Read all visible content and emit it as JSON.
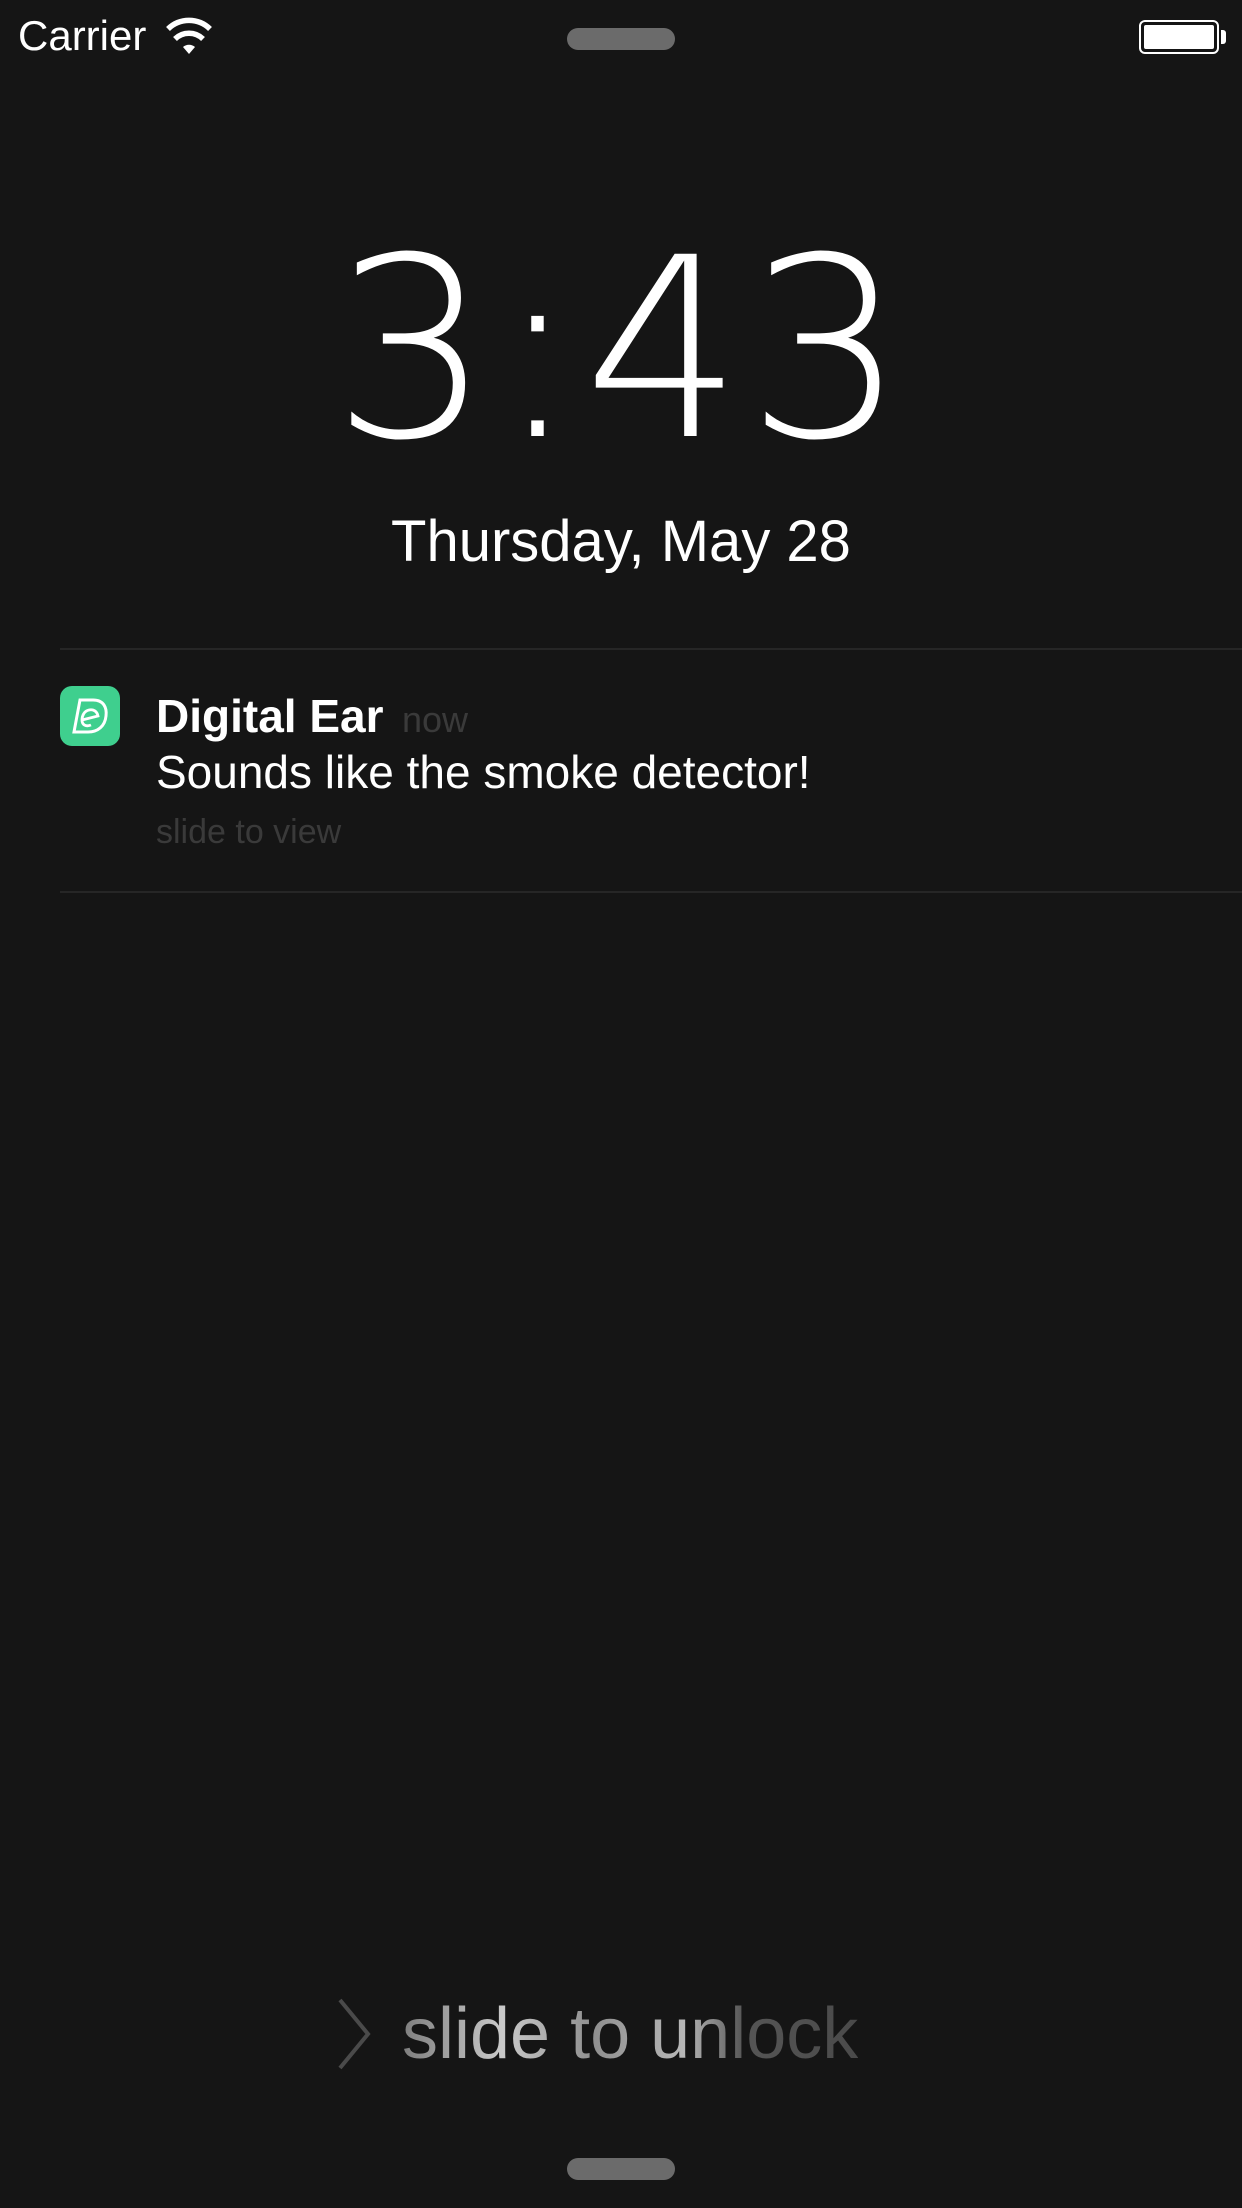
{
  "status_bar": {
    "carrier": "Carrier",
    "wifi_icon": "wifi-icon",
    "battery_icon": "battery-icon",
    "battery_level": 1.0
  },
  "lock_screen": {
    "time": "3:43",
    "date": "Thursday, May 28"
  },
  "notification": {
    "app_icon": "digital-ear-app-icon",
    "app_icon_color": "#3fcf8e",
    "app_name": "Digital Ear",
    "time": "now",
    "message": "Sounds like the smoke detector!",
    "hint": "slide to view"
  },
  "unlock": {
    "chevron_icon": "chevron-right-icon",
    "label": "slide to unlock"
  },
  "colors": {
    "background": "#151515",
    "text": "#ffffff",
    "secondary_text": "#3a3a3a",
    "accent": "#3fcf8e"
  }
}
